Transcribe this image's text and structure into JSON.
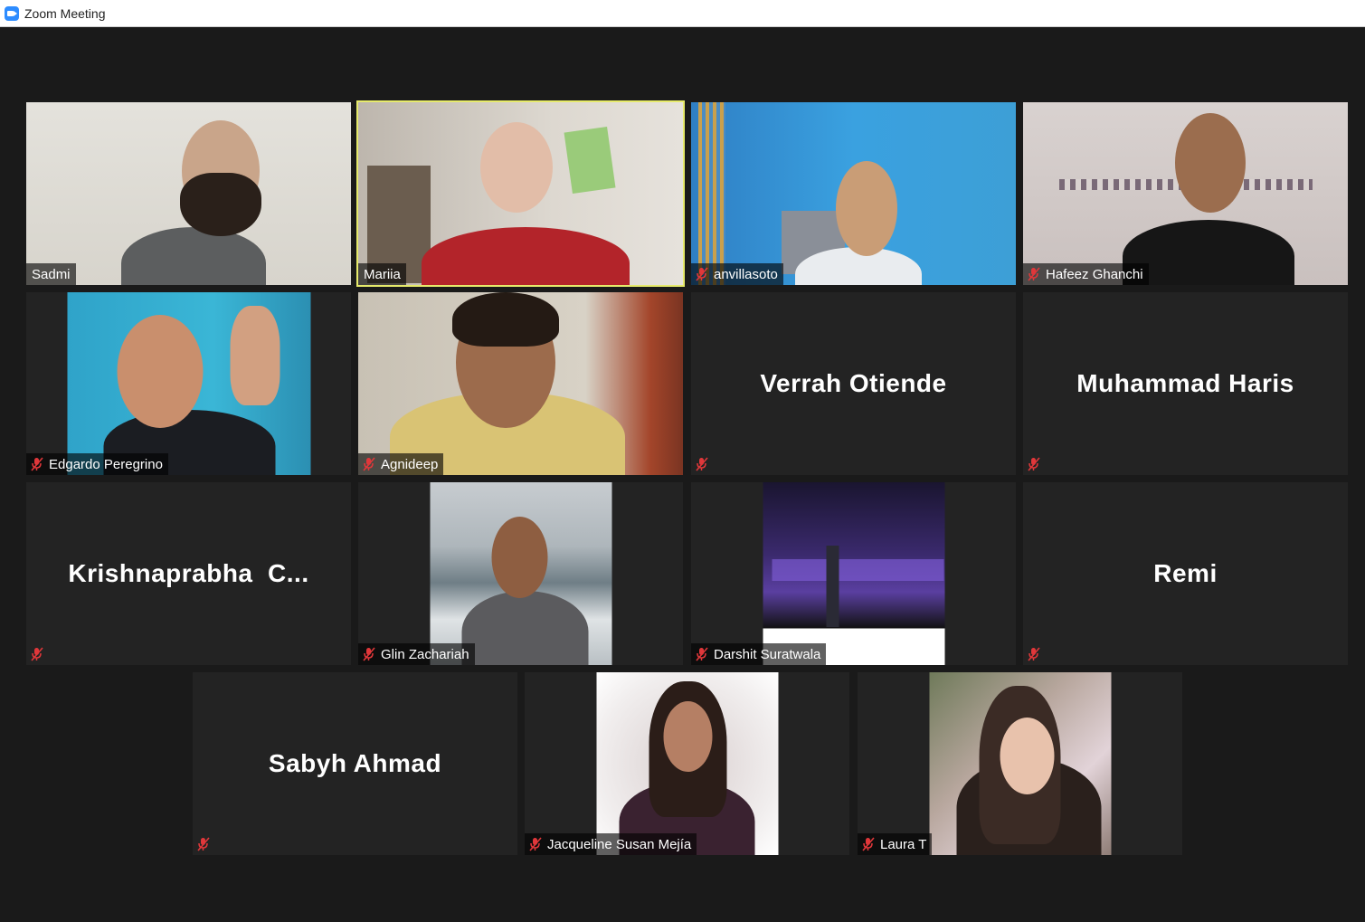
{
  "window": {
    "title": "Zoom Meeting"
  },
  "accent": {
    "active_speaker": "#e6ea6b",
    "mute_icon": "#e0373a"
  },
  "participants": [
    {
      "name": "Sadmi",
      "muted": false,
      "video": true
    },
    {
      "name": "Mariia",
      "muted": false,
      "video": true,
      "active_speaker": true
    },
    {
      "name": "anvillasoto",
      "muted": true,
      "video": true
    },
    {
      "name": "Hafeez Ghanchi",
      "muted": true,
      "video": true
    },
    {
      "name": "Edgardo Peregrino",
      "muted": true,
      "video": true
    },
    {
      "name": "Agnideep",
      "muted": true,
      "video": true
    },
    {
      "name": "Verrah Otiende",
      "muted": true,
      "video": false
    },
    {
      "name": "Muhammad Haris",
      "muted": true,
      "video": false
    },
    {
      "name": "Krishnaprabha  C...",
      "muted": true,
      "video": false
    },
    {
      "name": "Glin Zachariah",
      "muted": true,
      "video": true
    },
    {
      "name": "Darshit Suratwala",
      "muted": true,
      "video": true
    },
    {
      "name": "Remi",
      "muted": true,
      "video": false
    },
    {
      "name": "Sabyh Ahmad",
      "muted": true,
      "video": false
    },
    {
      "name": "Jacqueline Susan Mejía",
      "muted": true,
      "video": true
    },
    {
      "name": "Laura T",
      "muted": true,
      "video": true
    }
  ]
}
